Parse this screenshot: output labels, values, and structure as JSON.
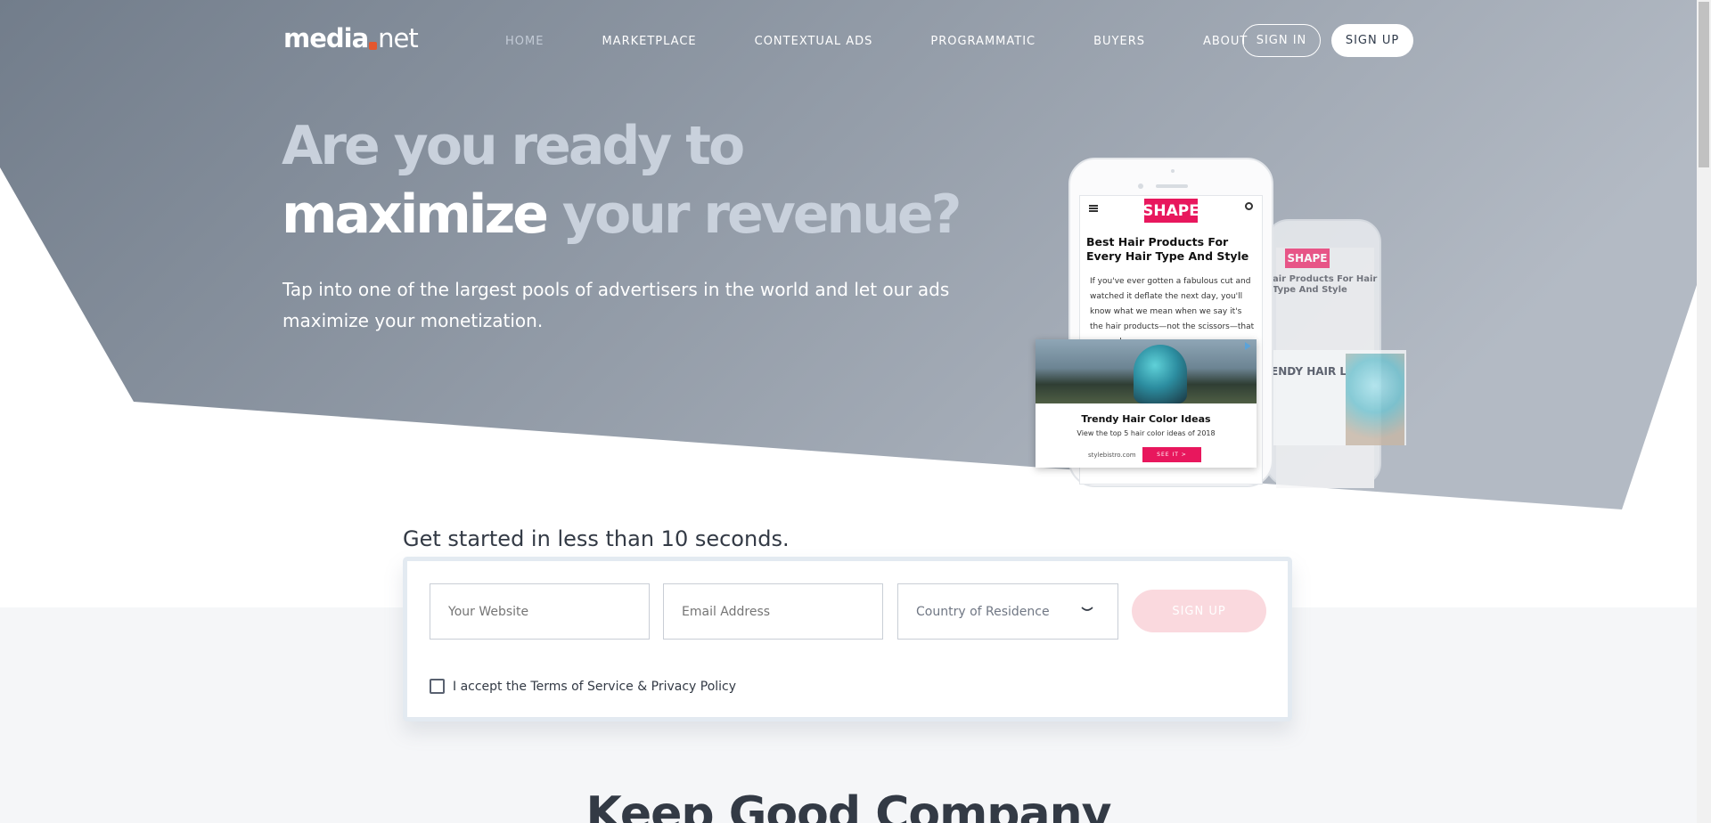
{
  "brand": {
    "logo_left": "media",
    "logo_right": "net"
  },
  "nav": {
    "items": [
      "HOME",
      "MARKETPLACE",
      "CONTEXTUAL ADS",
      "PROGRAMMATIC",
      "BUYERS",
      "ABOUT"
    ],
    "sign_in": "SIGN IN",
    "sign_up": "SIGN UP"
  },
  "hero": {
    "line1": "Are you ready to",
    "line2_strong": "maximize",
    "line2_rest": " your revenue?",
    "subtitle": "Tap into one of the largest pools of advertisers in the world and let our ads maximize your monetization."
  },
  "illustration": {
    "brand": "SHAPE",
    "article_title": "Best Hair Products For Every Hair Type And Style",
    "article_text": "If you've ever gotten a fabulous cut and watched it deflate the next day, you'll know what we mean when we say it's the hair products—not the scissors—that can make",
    "back_title": "air Products For Hair Type And Style",
    "ad_title": "Trendy Hair Color Ideas",
    "ad_desc": "View the top 5 hair color ideas of 2018",
    "ad_site": "stylebistro.com",
    "ad_cta": "SEE IT >",
    "back_ad_title": "ENDY HAIR LOR IDEAS"
  },
  "signup": {
    "heading": "Get started in less than 10 seconds.",
    "website_placeholder": "Your Website",
    "email_placeholder": "Email Address",
    "country_placeholder": "Country of Residence",
    "button": "SIGN UP",
    "terms_prefix": "I accept the ",
    "terms_tos": "Terms of Service",
    "terms_amp": " & ",
    "terms_privacy": "Privacy Policy"
  },
  "next_section": {
    "title": "Keep Good Company"
  },
  "colors": {
    "hero_gradient_start": "#727d8b",
    "hero_gradient_end": "#b3bac4",
    "accent_pink": "#e8175d",
    "signup_button_disabled": "#fad9de"
  }
}
